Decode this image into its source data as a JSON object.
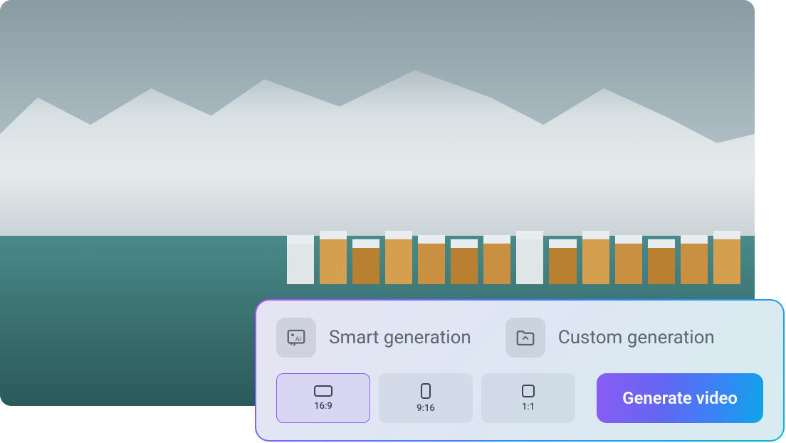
{
  "generation_options": {
    "smart": {
      "label": "Smart generation",
      "icon": "smart-ai-icon"
    },
    "custom": {
      "label": "Custom generation",
      "icon": "folder-icon"
    }
  },
  "aspect_ratios": [
    {
      "label": "16:9",
      "shape": "r169",
      "active": true
    },
    {
      "label": "9:16",
      "shape": "r916",
      "active": false
    },
    {
      "label": "1:1",
      "shape": "r11",
      "active": false
    }
  ],
  "generate_button": {
    "label": "Generate video"
  },
  "colors": {
    "accent_gradient_start": "#8b5cf6",
    "accent_gradient_end": "#0ea5e9",
    "border_gradient": "#a855f7"
  }
}
